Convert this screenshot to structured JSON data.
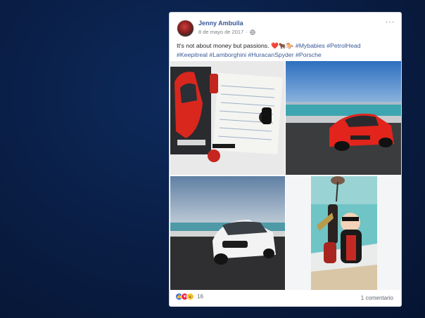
{
  "post": {
    "author": "Jenny Ambuila",
    "date": "8 de mayo de 2017",
    "separator": "·",
    "more_menu": "···",
    "text_prefix": "It's not about money but passions. ",
    "emoji": "❤️🐂🐎",
    "hashtags_line1": "#Mybabies #PetrolHead",
    "hashtags_line2": "#Keepitreal #Lamborghini #HuracanSpyder #Porsche"
  },
  "footer": {
    "reaction_count": "16",
    "comments_label": "1 comentario"
  },
  "photos": [
    {
      "name": "photo-lamborghini-model-and-documents"
    },
    {
      "name": "photo-red-huracan-spyder-seaside"
    },
    {
      "name": "photo-white-porsche-cayenne-seaside"
    },
    {
      "name": "photo-keychain-figure-beach"
    }
  ],
  "colors": {
    "accent": "#385898",
    "background": "#0a1f47"
  }
}
